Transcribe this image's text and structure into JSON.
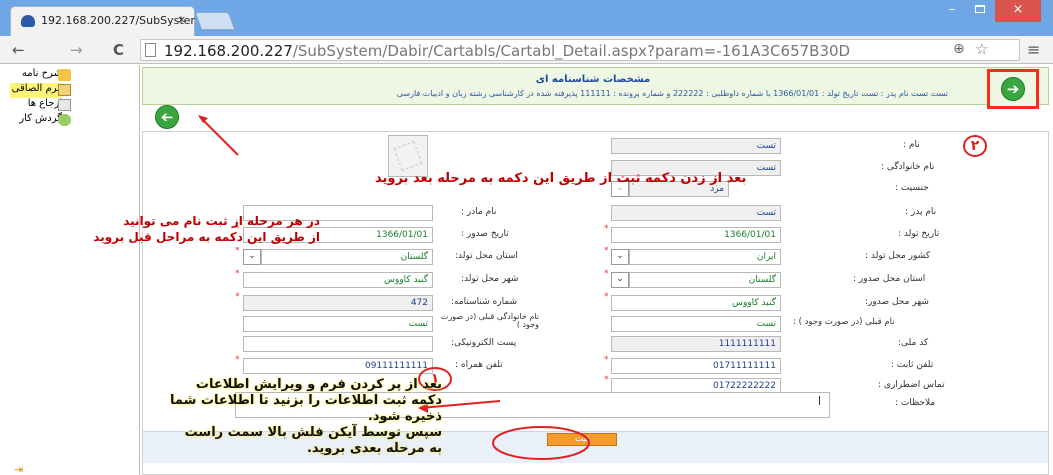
{
  "browser": {
    "tab_title": "192.168.200.227/SubSyster",
    "tab_close": "×",
    "url_host": "192.168.200.227",
    "url_path": "/SubSystem/Dabir/Cartabls/Cartabl_Detail.aspx?param=-161A3C657B30D",
    "back": "←",
    "forward": "→",
    "reload": "C",
    "zoom": "⊕",
    "star": "☆",
    "menu": "≡",
    "win_min": "–",
    "win_close": "×"
  },
  "sidebar": {
    "items": [
      {
        "label": "شرح نامه",
        "icon": "note-icon",
        "active": false
      },
      {
        "label": "فرم الصاقی",
        "icon": "form-icon",
        "active": true
      },
      {
        "label": "ارجاع ها",
        "icon": "refer-icon",
        "active": false
      },
      {
        "label": "گردش کار",
        "icon": "workflow-icon",
        "active": false
      }
    ],
    "bottom_arrow": "⇥"
  },
  "header": {
    "title": "مشخصات شناسنامه ای",
    "subtitle": "تست تست نام پدر : تست تاریخ تولد : 1366/01/01 با شماره داوطلبی : 222222 و شماره پرونده : 111111 پذیرفته شده در کارشناسی رشته زبان و ادبیات فارسی",
    "next_arrow": "➔",
    "prev_arrow": "➔"
  },
  "form": {
    "name_label": "نام :",
    "name_value": "تست",
    "family_label": "نام خانوادگی :",
    "family_value": "تست",
    "gender_label": "جنسیت :",
    "gender_value": "مرد",
    "father_label": "نام پدر :",
    "father_value": "تست",
    "mother_label": "نام مادر :",
    "mother_value": "",
    "birth_date_label": "تاریخ تولد :",
    "birth_date_value": "1366/01/01",
    "issue_date_label": "تاریخ صدور :",
    "issue_date_value": "1366/01/01",
    "birth_country_label": "کشور محل تولد :",
    "birth_country_value": "ایران",
    "birth_province_label": "استان محل تولد:",
    "birth_province_value": "گلستان",
    "issue_province_label": "استان محل صدور :",
    "issue_province_value": "گلستان",
    "birth_city_label": "شهر محل تولد:",
    "birth_city_value": "گنبد کاووس",
    "issue_city_label": "شهر محل صدور:",
    "issue_city_value": "گنبد کاووس",
    "id_number_label": "شماره شناسنامه:",
    "id_number_value": "472",
    "prev_name_label": "نام قبلی (در صورت وجود ) :",
    "prev_name_value": "تست",
    "prev_family_label": "نام خانوادگی قبلی (در صورت وجود )",
    "prev_family_value": "تست",
    "national_code_label": "کد ملی:",
    "national_code_value": "1111111111",
    "email_label": "پست الکترونیکی:",
    "email_value": "",
    "phone_label": "تلفن ثابت :",
    "phone_value": "01711111111",
    "mobile_label": "تلفن همراه :",
    "mobile_value": "09111111111",
    "emergency_label": "تماس اضطراری :",
    "emergency_value": "01722222222",
    "notes_label": "ملاحظات :",
    "submit_label": "ثبت",
    "required_mark": "*",
    "select_arrow": "⌄"
  },
  "annotations": {
    "top": "بعد از زدن دکمه ثبت از طریق این دکمه به مرحله بعد بروید",
    "top_number": "۲",
    "left_line1": "در هر مرحله از ثبت نام می توانید",
    "left_line2": "از طریق این دکمه به مراحل قبل بروید",
    "bottom_line1": "بعد از پر کردن فرم و ویرایش اطلاعات",
    "bottom_line2": "دکمه ثبت اطلاعات را بزنید تا اطلاعات شما",
    "bottom_line3": "ذخیره شود.",
    "bottom_line4": "سپس توسط آیکن فلش بالا سمت راست",
    "bottom_line5": "به مرحله بعدی بروید.",
    "bottom_number": "۱"
  },
  "colors": {
    "annotation_red": "#e02020",
    "header_bg": "#eef7e3",
    "arrow_green": "#3aa640",
    "submit_orange": "#f39b2b"
  }
}
